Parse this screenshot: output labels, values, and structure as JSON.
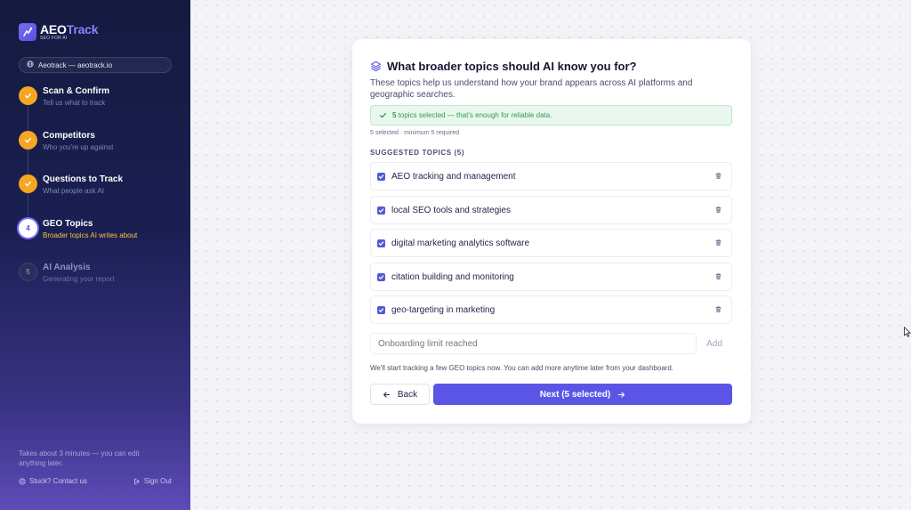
{
  "brand": {
    "name_a": "AEO",
    "name_b": "Track",
    "tagline": "SEO FOR AI"
  },
  "site": {
    "label": "Aeotrack — aeotrack.io"
  },
  "steps": [
    {
      "number": "1",
      "title": "Scan & Confirm",
      "subtitle": "Tell us what to track",
      "state": "done"
    },
    {
      "number": "2",
      "title": "Competitors",
      "subtitle": "Who you're up against",
      "state": "done"
    },
    {
      "number": "3",
      "title": "Questions to Track",
      "subtitle": "What people ask AI",
      "state": "done"
    },
    {
      "number": "4",
      "title": "GEO Topics",
      "subtitle": "Broader topics AI writes about",
      "state": "active"
    },
    {
      "number": "5",
      "title": "AI Analysis",
      "subtitle": "Generating your report",
      "state": "todo"
    }
  ],
  "sidebar_footer": {
    "note": "Takes about 3 minutes — you can edit anything later.",
    "help": "Stuck? Contact us",
    "signout": "Sign Out"
  },
  "card": {
    "title": "What broader topics should AI know you for?",
    "description": "These topics help us understand how your brand appears across AI platforms and geographic searches.",
    "success_count": "5",
    "success_text": "topics selected — that's enough for reliable data.",
    "count_note": "5 selected · minimum 5 required",
    "section_label": "SUGGESTED TOPICS (5)",
    "topics": [
      {
        "label": "AEO tracking and management",
        "checked": true
      },
      {
        "label": "local SEO tools and strategies",
        "checked": true
      },
      {
        "label": "digital marketing analytics software",
        "checked": true
      },
      {
        "label": "citation building and monitoring",
        "checked": true
      },
      {
        "label": "geo-targeting in marketing",
        "checked": true
      }
    ],
    "add_placeholder": "Onboarding limit reached",
    "add_label": "Add",
    "hint": "We'll start tracking a few GEO topics now. You can add more anytime later from your dashboard.",
    "back_label": "Back",
    "next_label": "Next (5 selected)"
  },
  "colors": {
    "accent": "#5b55e6",
    "done": "#f5a623",
    "success": "#2e9a55"
  }
}
